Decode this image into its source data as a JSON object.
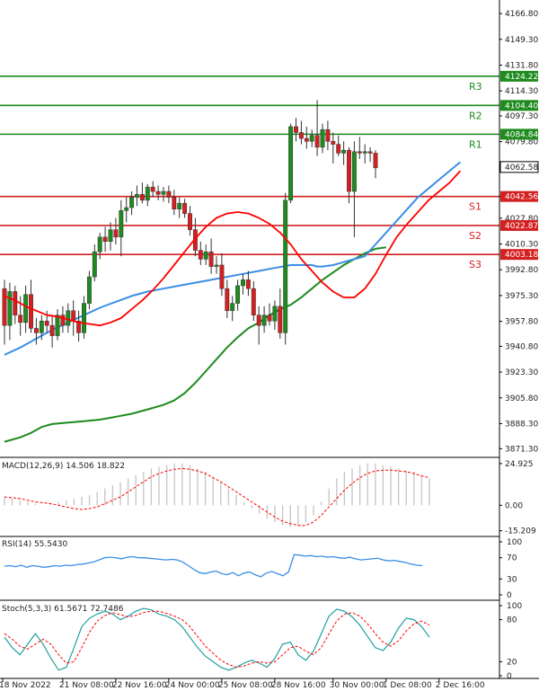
{
  "chart_data": {
    "type": "candlestick",
    "colors": {
      "up": "#1e8b1e",
      "down": "#d42020",
      "ma_fast": "#ff0000",
      "ma_mid": "#3a8ee6",
      "ma_slow": "#1e8b1e",
      "resistance": "#1e8b1e",
      "support": "#d42020",
      "macd_hist": "#c8c8c8",
      "macd_signal": "#ff0000",
      "rsi": "#3a8ee6",
      "stoch_k": "#20a0a0",
      "stoch_d": "#ff0000"
    },
    "price_axis": {
      "ticks": [
        "4166.80",
        "4149.30",
        "4131.80",
        "4114.30",
        "4097.30",
        "4079.80",
        "4062.58",
        "4042.56",
        "4027.80",
        "4010.30",
        "3992.80",
        "3975.30",
        "3957.80",
        "3940.80",
        "3923.30",
        "3905.80",
        "3888.30",
        "3871.30"
      ],
      "ylim": [
        3866,
        4176
      ]
    },
    "levels": [
      {
        "name": "R3",
        "value": 4124.22,
        "label": "4124.22",
        "kind": "resistance"
      },
      {
        "name": "R2",
        "value": 4104.4,
        "label": "4104.40",
        "kind": "resistance"
      },
      {
        "name": "R1",
        "value": 4084.84,
        "label": "4084.84",
        "kind": "resistance"
      },
      {
        "name": "S1",
        "value": 4042.56,
        "label": "4042.56",
        "kind": "support"
      },
      {
        "name": "S2",
        "value": 4022.87,
        "label": "4022.87",
        "kind": "support"
      },
      {
        "name": "S3",
        "value": 4003.18,
        "label": "4003.18",
        "kind": "support"
      }
    ],
    "last_price": {
      "value": 4062.58,
      "label": "4062.58"
    },
    "x_axis": {
      "labels": [
        "18 Nov 2022",
        "21 Nov 08:00",
        "22 Nov 16:00",
        "24 Nov 00:00",
        "25 Nov 08:00",
        "28 Nov 16:00",
        "30 Nov 00:00",
        "1 Dec 08:00",
        "2 Dec 16:00"
      ],
      "label_bars": [
        0,
        11,
        21,
        31,
        41,
        51,
        62,
        72,
        82
      ]
    },
    "candles": [
      {
        "o": 3980,
        "h": 3986,
        "l": 3942,
        "c": 3955
      },
      {
        "o": 3955,
        "h": 3984,
        "l": 3945,
        "c": 3978
      },
      {
        "o": 3978,
        "h": 3982,
        "l": 3956,
        "c": 3962
      },
      {
        "o": 3962,
        "h": 3975,
        "l": 3948,
        "c": 3957
      },
      {
        "o": 3957,
        "h": 3982,
        "l": 3950,
        "c": 3976
      },
      {
        "o": 3976,
        "h": 3986,
        "l": 3950,
        "c": 3953
      },
      {
        "o": 3953,
        "h": 3960,
        "l": 3942,
        "c": 3950
      },
      {
        "o": 3950,
        "h": 3962,
        "l": 3945,
        "c": 3958
      },
      {
        "o": 3958,
        "h": 3965,
        "l": 3950,
        "c": 3955
      },
      {
        "o": 3955,
        "h": 3962,
        "l": 3940,
        "c": 3948
      },
      {
        "o": 3948,
        "h": 3966,
        "l": 3945,
        "c": 3962
      },
      {
        "o": 3962,
        "h": 3968,
        "l": 3950,
        "c": 3955
      },
      {
        "o": 3955,
        "h": 3970,
        "l": 3950,
        "c": 3965
      },
      {
        "o": 3965,
        "h": 3972,
        "l": 3948,
        "c": 3958
      },
      {
        "o": 3958,
        "h": 3965,
        "l": 3944,
        "c": 3950
      },
      {
        "o": 3950,
        "h": 3975,
        "l": 3946,
        "c": 3970
      },
      {
        "o": 3970,
        "h": 3992,
        "l": 3966,
        "c": 3988
      },
      {
        "o": 3988,
        "h": 4010,
        "l": 3985,
        "c": 4005
      },
      {
        "o": 4005,
        "h": 4018,
        "l": 4000,
        "c": 4015
      },
      {
        "o": 4015,
        "h": 4022,
        "l": 4005,
        "c": 4012
      },
      {
        "o": 4012,
        "h": 4025,
        "l": 4006,
        "c": 4020
      },
      {
        "o": 4020,
        "h": 4028,
        "l": 4010,
        "c": 4015
      },
      {
        "o": 4015,
        "h": 4040,
        "l": 4002,
        "c": 4033
      },
      {
        "o": 4033,
        "h": 4042,
        "l": 4025,
        "c": 4035
      },
      {
        "o": 4035,
        "h": 4046,
        "l": 4030,
        "c": 4042
      },
      {
        "o": 4042,
        "h": 4050,
        "l": 4036,
        "c": 4044
      },
      {
        "o": 4044,
        "h": 4052,
        "l": 4038,
        "c": 4040
      },
      {
        "o": 4040,
        "h": 4051,
        "l": 4036,
        "c": 4049
      },
      {
        "o": 4049,
        "h": 4053,
        "l": 4042,
        "c": 4046
      },
      {
        "o": 4046,
        "h": 4050,
        "l": 4040,
        "c": 4044
      },
      {
        "o": 4044,
        "h": 4049,
        "l": 4039,
        "c": 4046
      },
      {
        "o": 4046,
        "h": 4050,
        "l": 4038,
        "c": 4042
      },
      {
        "o": 4042,
        "h": 4047,
        "l": 4030,
        "c": 4034
      },
      {
        "o": 4034,
        "h": 4042,
        "l": 4028,
        "c": 4038
      },
      {
        "o": 4038,
        "h": 4041,
        "l": 4028,
        "c": 4031
      },
      {
        "o": 4031,
        "h": 4036,
        "l": 4016,
        "c": 4020
      },
      {
        "o": 4020,
        "h": 4028,
        "l": 4002,
        "c": 4006
      },
      {
        "o": 4006,
        "h": 4012,
        "l": 3996,
        "c": 4000
      },
      {
        "o": 4000,
        "h": 4010,
        "l": 3996,
        "c": 4005
      },
      {
        "o": 4005,
        "h": 4014,
        "l": 3990,
        "c": 3995
      },
      {
        "o": 3995,
        "h": 4002,
        "l": 3990,
        "c": 3996
      },
      {
        "o": 3996,
        "h": 4004,
        "l": 3975,
        "c": 3980
      },
      {
        "o": 3980,
        "h": 3986,
        "l": 3960,
        "c": 3965
      },
      {
        "o": 3965,
        "h": 3975,
        "l": 3958,
        "c": 3970
      },
      {
        "o": 3970,
        "h": 3986,
        "l": 3965,
        "c": 3982
      },
      {
        "o": 3982,
        "h": 3990,
        "l": 3976,
        "c": 3986
      },
      {
        "o": 3986,
        "h": 3992,
        "l": 3975,
        "c": 3980
      },
      {
        "o": 3980,
        "h": 3985,
        "l": 3958,
        "c": 3962
      },
      {
        "o": 3962,
        "h": 3968,
        "l": 3942,
        "c": 3955
      },
      {
        "o": 3955,
        "h": 3968,
        "l": 3950,
        "c": 3962
      },
      {
        "o": 3962,
        "h": 3970,
        "l": 3955,
        "c": 3958
      },
      {
        "o": 3958,
        "h": 3972,
        "l": 3952,
        "c": 3968
      },
      {
        "o": 3968,
        "h": 3980,
        "l": 3946,
        "c": 3950
      },
      {
        "o": 3950,
        "h": 4045,
        "l": 3942,
        "c": 4040
      },
      {
        "o": 4040,
        "h": 4092,
        "l": 4038,
        "c": 4090
      },
      {
        "o": 4090,
        "h": 4096,
        "l": 4080,
        "c": 4086
      },
      {
        "o": 4086,
        "h": 4094,
        "l": 4078,
        "c": 4082
      },
      {
        "o": 4082,
        "h": 4090,
        "l": 4075,
        "c": 4080
      },
      {
        "o": 4080,
        "h": 4088,
        "l": 4076,
        "c": 4084
      },
      {
        "o": 4084,
        "h": 4108,
        "l": 4070,
        "c": 4076
      },
      {
        "o": 4076,
        "h": 4092,
        "l": 4072,
        "c": 4088
      },
      {
        "o": 4088,
        "h": 4094,
        "l": 4074,
        "c": 4080
      },
      {
        "o": 4080,
        "h": 4086,
        "l": 4065,
        "c": 4078
      },
      {
        "o": 4078,
        "h": 4084,
        "l": 4070,
        "c": 4072
      },
      {
        "o": 4072,
        "h": 4080,
        "l": 4064,
        "c": 4074
      },
      {
        "o": 4074,
        "h": 4076,
        "l": 4038,
        "c": 4046
      },
      {
        "o": 4046,
        "h": 4080,
        "l": 4015,
        "c": 4073
      },
      {
        "o": 4073,
        "h": 4083,
        "l": 4068,
        "c": 4072
      },
      {
        "o": 4072,
        "h": 4078,
        "l": 4065,
        "c": 4073
      },
      {
        "o": 4073,
        "h": 4076,
        "l": 4066,
        "c": 4072
      },
      {
        "o": 4072,
        "h": 4074,
        "l": 4055,
        "c": 4062
      }
    ],
    "ma_fast": [
      3975,
      3972,
      3968,
      3965,
      3962,
      3961,
      3959,
      3957,
      3956,
      3955,
      3957,
      3960,
      3966,
      3972,
      3979,
      3987,
      3996,
      4005,
      4014,
      4022,
      4028,
      4031,
      4032,
      4031,
      4028,
      4024,
      4018,
      4010,
      4000,
      3992,
      3984,
      3978,
      3974,
      3974,
      3980,
      3990,
      4003,
      4015,
      4024,
      4032,
      4040,
      4046,
      4052,
      4060
    ],
    "ma_fast_bars": [
      0,
      2,
      4,
      6,
      8,
      10,
      12,
      14,
      16,
      18,
      20,
      22,
      24,
      26,
      28,
      30,
      32,
      34,
      36,
      38,
      40,
      42,
      44,
      46,
      48,
      50,
      52,
      54,
      56,
      58,
      60,
      62,
      64,
      66,
      68,
      70,
      72,
      74,
      76,
      78,
      80,
      82,
      84,
      86
    ],
    "ma_mid": [
      3935,
      3940,
      3946,
      3952,
      3957,
      3962,
      3967,
      3971,
      3975,
      3978,
      3980,
      3982,
      3984,
      3986,
      3988,
      3990,
      3992,
      3994,
      3996,
      3996,
      3996,
      3995,
      3995,
      3996,
      3998,
      4000,
      4002,
      4010,
      4018,
      4026,
      4034,
      4042,
      4048,
      4054,
      4060,
      4066
    ],
    "ma_mid_bars": [
      0,
      3,
      6,
      9,
      12,
      15,
      18,
      21,
      24,
      27,
      30,
      33,
      36,
      39,
      42,
      45,
      48,
      51,
      54,
      57,
      58,
      59,
      60,
      62,
      64,
      66,
      68,
      70,
      72,
      74,
      76,
      78,
      80,
      82,
      84,
      86
    ],
    "ma_slow": [
      3876,
      3879,
      3882,
      3886,
      3888,
      3889,
      3890,
      3891,
      3893,
      3895,
      3898,
      3901,
      3904,
      3909,
      3916,
      3924,
      3932,
      3940,
      3947,
      3953,
      3957,
      3962,
      3966,
      3969,
      3974,
      3980,
      3986,
      3991,
      3996,
      4000,
      4004,
      4007,
      4008
    ],
    "ma_slow_bars": [
      0,
      3,
      5,
      7,
      9,
      12,
      15,
      18,
      21,
      24,
      27,
      30,
      32,
      34,
      36,
      38,
      40,
      42,
      44,
      46,
      48,
      50,
      52,
      54,
      56,
      58,
      60,
      62,
      64,
      66,
      68,
      70,
      72
    ],
    "macd": {
      "label": "MACD(12,26,9) 14.506 18.822",
      "ticks": [
        "24.925",
        "0.00",
        "-15.209"
      ],
      "ylim": [
        -17,
        27
      ],
      "histogram": [
        5,
        4,
        3,
        2,
        1,
        0,
        1,
        2,
        3,
        4,
        5,
        6,
        8,
        10,
        12,
        14,
        16,
        18,
        20,
        22,
        23,
        24,
        25,
        25,
        24,
        22,
        20,
        17,
        14,
        10,
        6,
        2,
        -2,
        -5,
        -8,
        -10,
        -12,
        -13,
        -12,
        -10,
        -6,
        2,
        10,
        16,
        20,
        22,
        24,
        25,
        25,
        24,
        23,
        22,
        21,
        20,
        18,
        16
      ],
      "signal": [
        5,
        4.5,
        4,
        3,
        2,
        1.5,
        1,
        0,
        -1,
        -2,
        -2.5,
        -2,
        -1,
        1,
        3,
        5,
        8,
        11,
        14,
        17,
        19,
        20.5,
        21.5,
        22,
        21.5,
        20.5,
        19,
        16.5,
        14,
        11,
        8,
        5,
        2,
        -1,
        -4,
        -7,
        -9.5,
        -11,
        -12,
        -12,
        -10,
        -6,
        -1,
        4,
        9,
        13,
        16.5,
        19,
        20.5,
        21,
        21,
        20.5,
        20,
        19,
        17.5,
        16.5
      ]
    },
    "rsi": {
      "label": "RSI(14) 55.5430",
      "ticks": [
        "100",
        "70",
        "30",
        "0"
      ],
      "ylim": [
        0,
        100
      ],
      "values": [
        54,
        55,
        53,
        56,
        52,
        55,
        54,
        52,
        53,
        55,
        54,
        56,
        55,
        57,
        58,
        60,
        62,
        66,
        70,
        71,
        70,
        68,
        71,
        72,
        70,
        70,
        69,
        68,
        67,
        66,
        67,
        66,
        62,
        55,
        48,
        42,
        40,
        43,
        45,
        40,
        38,
        42,
        36,
        41,
        43,
        38,
        34,
        41,
        44,
        40,
        36,
        43,
        76,
        75,
        73,
        74,
        72,
        73,
        71,
        72,
        70,
        69,
        71,
        68,
        66,
        67,
        68,
        69,
        66,
        64,
        65,
        63,
        61,
        58,
        56,
        55
      ],
      "start_bar": 0,
      "step_bars": 1.15
    },
    "stoch": {
      "label": "Stoch(5,3,3) 61.5671 72.7486",
      "ticks": [
        "100",
        "80",
        "20",
        "0"
      ],
      "ylim": [
        0,
        100
      ],
      "k": [
        55,
        40,
        30,
        45,
        60,
        45,
        25,
        8,
        12,
        40,
        70,
        82,
        88,
        92,
        88,
        80,
        85,
        92,
        96,
        94,
        88,
        85,
        80,
        70,
        55,
        40,
        28,
        20,
        12,
        8,
        12,
        18,
        22,
        18,
        12,
        25,
        45,
        48,
        30,
        22,
        35,
        60,
        85,
        95,
        92,
        84,
        72,
        56,
        40,
        36,
        48,
        68,
        82,
        80,
        70,
        55
      ],
      "d": [
        60,
        52,
        42,
        38,
        45,
        52,
        45,
        30,
        18,
        20,
        40,
        62,
        78,
        86,
        90,
        87,
        84,
        86,
        90,
        92,
        92,
        89,
        85,
        80,
        70,
        56,
        42,
        32,
        22,
        16,
        12,
        14,
        18,
        20,
        18,
        20,
        30,
        40,
        42,
        35,
        30,
        40,
        60,
        78,
        88,
        90,
        85,
        74,
        60,
        48,
        42,
        50,
        64,
        74,
        78,
        72
      ]
    }
  }
}
